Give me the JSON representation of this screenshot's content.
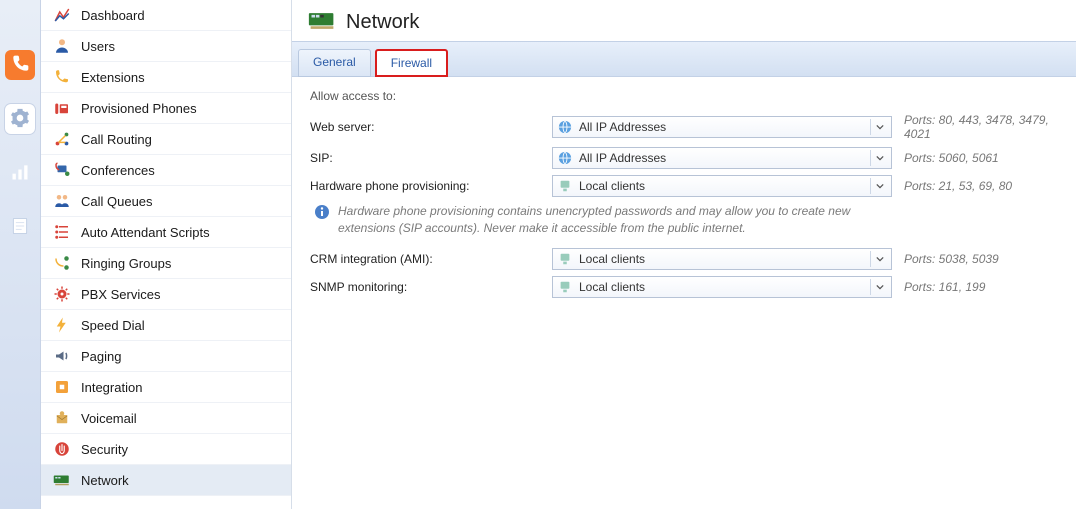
{
  "rail": {
    "items": [
      {
        "name": "phone-icon",
        "color": "#f77b2e"
      },
      {
        "name": "gear-icon",
        "color": "#a8b6cc",
        "active": true
      },
      {
        "name": "bars-icon",
        "color": "#ffffff"
      },
      {
        "name": "note-icon",
        "color": "#ffffff"
      }
    ]
  },
  "sidebar": {
    "items": [
      {
        "label": "Dashboard",
        "icon": "dashboard-icon"
      },
      {
        "label": "Users",
        "icon": "user-icon"
      },
      {
        "label": "Extensions",
        "icon": "handset-icon"
      },
      {
        "label": "Provisioned Phones",
        "icon": "deskphone-icon"
      },
      {
        "label": "Call Routing",
        "icon": "routing-icon"
      },
      {
        "label": "Conferences",
        "icon": "conference-icon"
      },
      {
        "label": "Call Queues",
        "icon": "queue-icon"
      },
      {
        "label": "Auto Attendant Scripts",
        "icon": "script-icon"
      },
      {
        "label": "Ringing Groups",
        "icon": "group-icon"
      },
      {
        "label": "PBX Services",
        "icon": "services-icon"
      },
      {
        "label": "Speed Dial",
        "icon": "bolt-icon"
      },
      {
        "label": "Paging",
        "icon": "speaker-icon"
      },
      {
        "label": "Integration",
        "icon": "puzzle-icon"
      },
      {
        "label": "Voicemail",
        "icon": "voicemail-icon"
      },
      {
        "label": "Security",
        "icon": "hand-stop-icon"
      },
      {
        "label": "Network",
        "icon": "nic-icon",
        "selected": true
      }
    ]
  },
  "page": {
    "title": "Network",
    "tabs": [
      {
        "label": "General",
        "active": false
      },
      {
        "label": "Firewall",
        "active": true
      }
    ]
  },
  "form": {
    "section_label": "Allow access to:",
    "rows": [
      {
        "label": "Web server:",
        "value": "All IP Addresses",
        "ports": "Ports: 80, 443, 3478, 3479, 4021",
        "icon": "globe-icon"
      },
      {
        "label": "SIP:",
        "value": "All IP Addresses",
        "ports": "Ports: 5060, 5061",
        "icon": "globe-icon"
      },
      {
        "label": "Hardware phone provisioning:",
        "value": "Local clients",
        "ports": "Ports: 21, 53, 69, 80",
        "icon": "local-icon"
      }
    ],
    "info": "Hardware phone provisioning contains unencrypted passwords and may allow you to create new extensions (SIP accounts). Never make it accessible from the public internet.",
    "rows2": [
      {
        "label": "CRM integration (AMI):",
        "value": "Local clients",
        "ports": "Ports: 5038, 5039",
        "icon": "local-icon"
      },
      {
        "label": "SNMP monitoring:",
        "value": "Local clients",
        "ports": "Ports: 161, 199",
        "icon": "local-icon"
      }
    ]
  }
}
